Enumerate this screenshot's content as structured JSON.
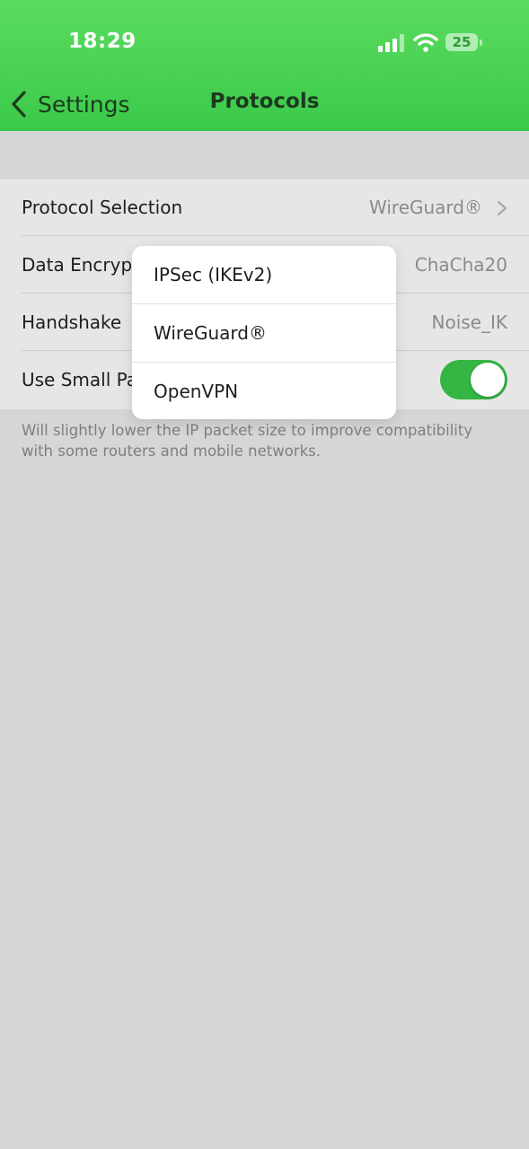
{
  "status_bar": {
    "time": "18:29",
    "battery": "25"
  },
  "nav": {
    "back_label": "Settings",
    "title": "Protocols"
  },
  "rows": [
    {
      "label": "Protocol Selection",
      "value": "WireGuard®"
    },
    {
      "label": "Data Encryption",
      "value": "ChaCha20"
    },
    {
      "label": "Handshake",
      "value": "Noise_IK"
    },
    {
      "label": "Use Small Packets",
      "toggle_on": true
    }
  ],
  "footnote": "Will slightly lower the IP packet size to improve compatibility with some routers and mobile networks.",
  "popup_options": [
    "IPSec (IKEv2)",
    "WireGuard®",
    "OpenVPN"
  ],
  "colors": {
    "header": "#4cd454",
    "toggle_on": "#34b544",
    "background": "#d6d6d6"
  }
}
